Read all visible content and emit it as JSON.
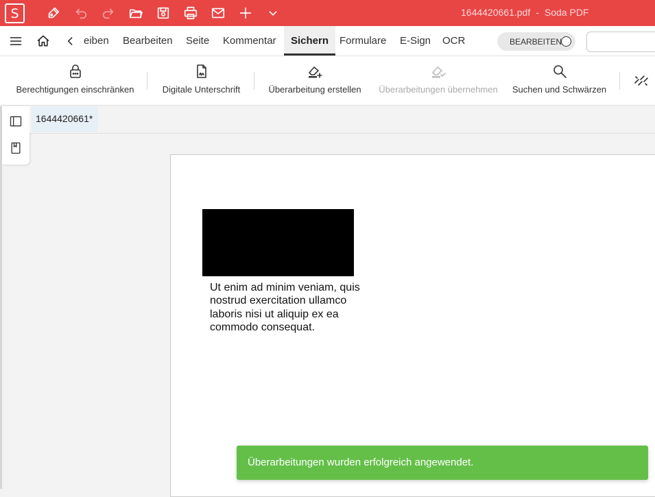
{
  "titlebar": {
    "logo_letter": "S",
    "file_name": "1644420661.pdf",
    "separator": "-",
    "app_name": "Soda PDF",
    "icons": [
      "pen-icon",
      "undo-icon",
      "redo-icon",
      "open-folder-icon",
      "save-icon",
      "print-icon",
      "mail-icon",
      "plus-icon",
      "chevron-down-icon"
    ]
  },
  "menubar": {
    "tabs": [
      {
        "label": "eiben"
      },
      {
        "label": "Bearbeiten"
      },
      {
        "label": "Seite"
      },
      {
        "label": "Kommentar"
      },
      {
        "label": "Sichern"
      },
      {
        "label": "Formulare"
      },
      {
        "label": "E-Sign"
      },
      {
        "label": "OCR"
      }
    ],
    "active_tab": "Sichern",
    "edit_toggle_label": "BEARBEITEN"
  },
  "ribbon": {
    "buttons": [
      {
        "label": "Berechtigungen einschränken",
        "icon": "lock-icon",
        "enabled": true
      },
      {
        "label": "Digitale Unterschrift",
        "icon": "signature-document-icon",
        "enabled": true
      },
      {
        "label": "Überarbeitung erstellen",
        "icon": "eraser-add-icon",
        "enabled": true
      },
      {
        "label": "Überarbeitungen übernehmen",
        "icon": "eraser-check-icon",
        "enabled": false
      },
      {
        "label": "Suchen und Schwärzen",
        "icon": "search-icon",
        "enabled": true
      }
    ]
  },
  "document": {
    "tab_label": "1644420661*",
    "paragraph": "Ut enim ad minim veniam, quis nostrud exercitation ullamco laboris nisi ut aliquip ex ea commodo consequat."
  },
  "toast": {
    "message": "Überarbeitungen wurden erfolgreich angewendet.",
    "color": "#64bf49"
  },
  "colors": {
    "brand": "#e84545",
    "active_tab_bg": "#efefef"
  }
}
